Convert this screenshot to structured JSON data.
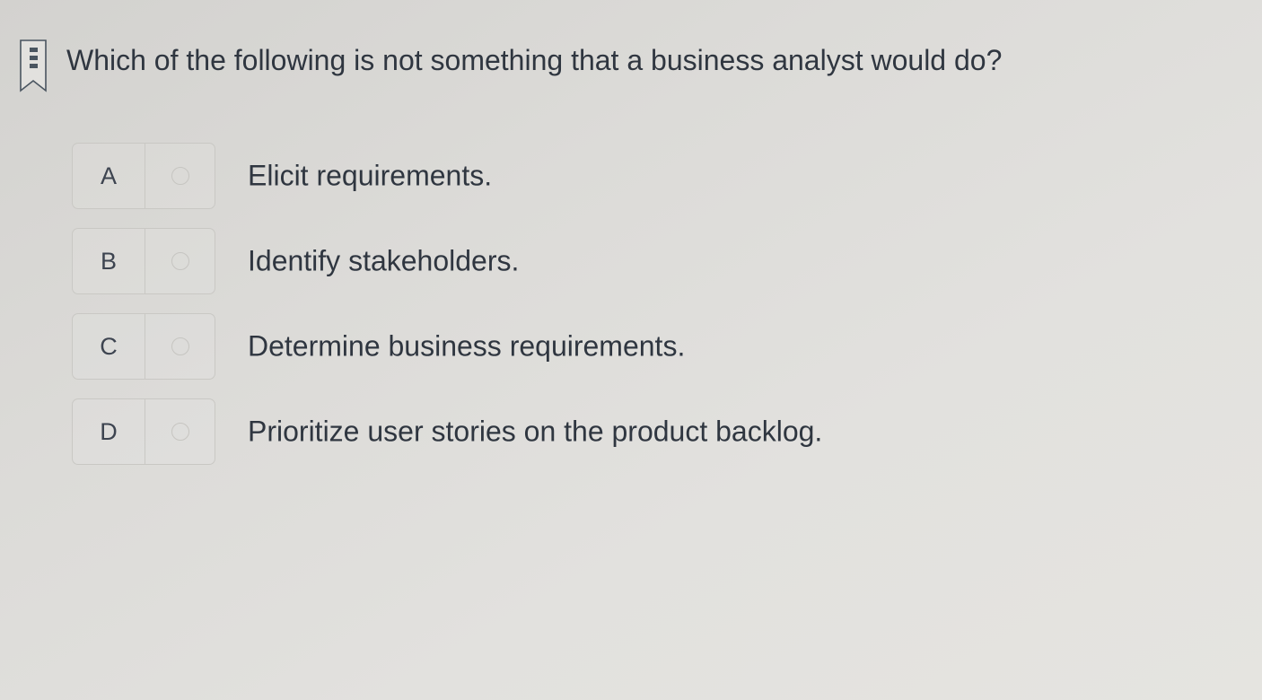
{
  "question": {
    "icon": "bookmark-flag-icon",
    "text": "Which of the following is not something that a business analyst would do?"
  },
  "options": [
    {
      "letter": "A",
      "text": "Elicit requirements.",
      "selected": false
    },
    {
      "letter": "B",
      "text": "Identify stakeholders.",
      "selected": false
    },
    {
      "letter": "C",
      "text": "Determine business requirements.",
      "selected": false
    },
    {
      "letter": "D",
      "text": "Prioritize user stories on the product backlog.",
      "selected": false
    }
  ]
}
